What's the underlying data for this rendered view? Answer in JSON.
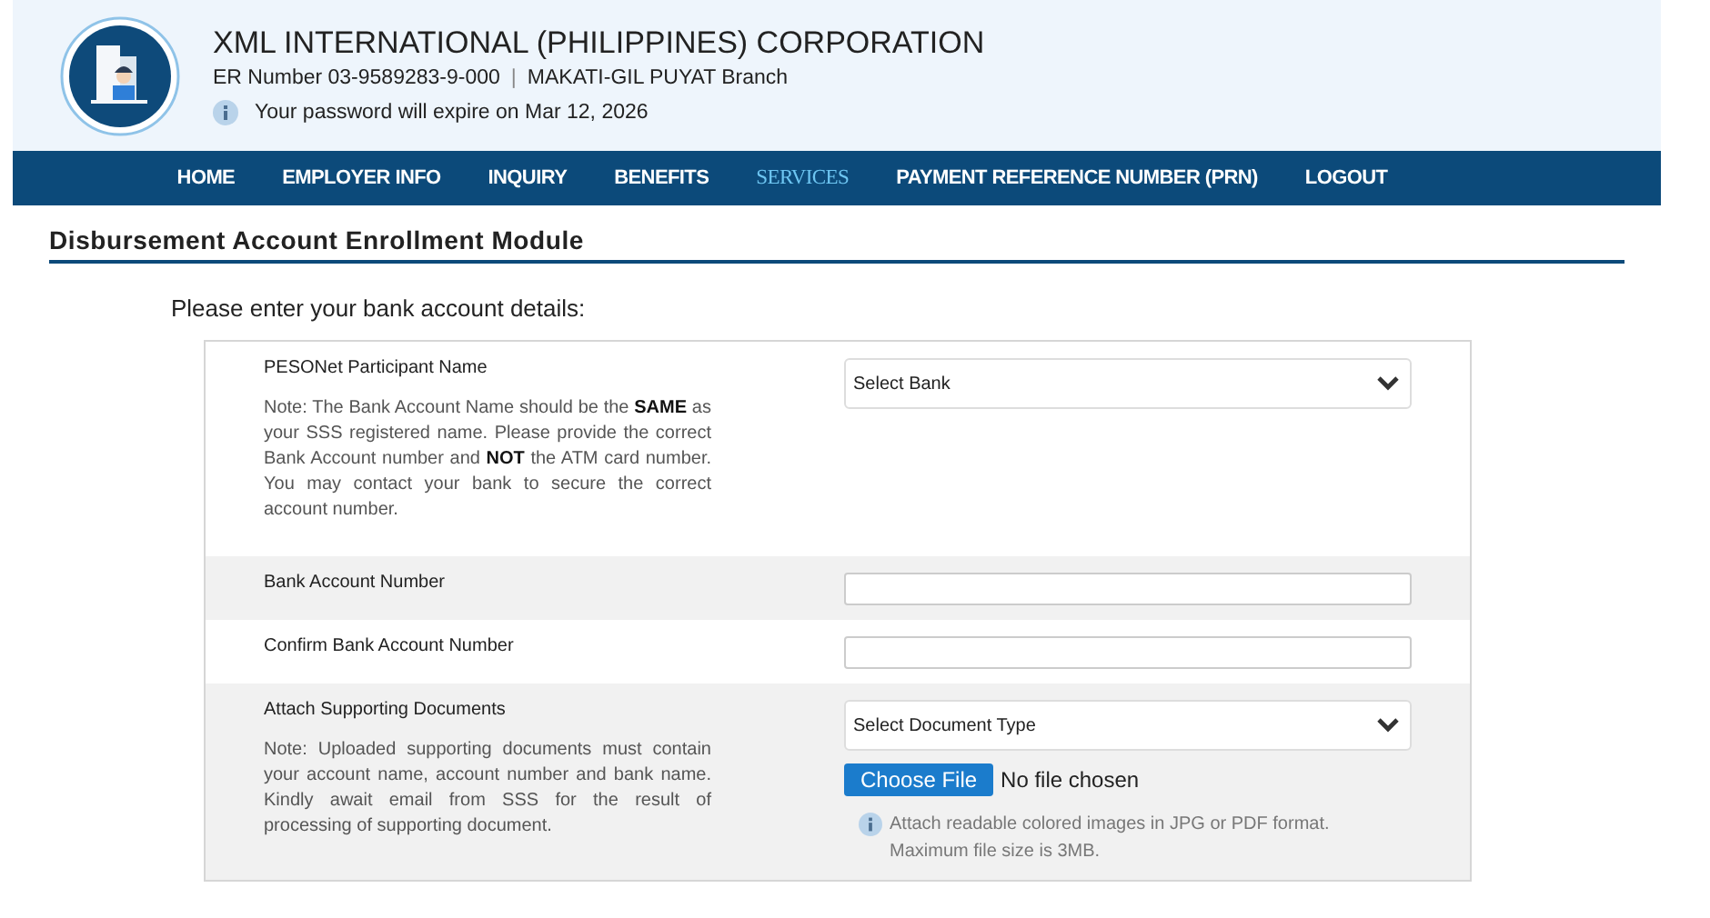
{
  "header": {
    "company": "XML INTERNATIONAL (PHILIPPINES) CORPORATION",
    "er_number": "ER Number 03-9589283-9-000",
    "separator": "|",
    "branch": "MAKATI-GIL PUYAT Branch",
    "password_notice": "Your password will expire on Mar 12, 2026"
  },
  "nav": [
    {
      "label": "HOME",
      "selected": false
    },
    {
      "label": "EMPLOYER INFO",
      "selected": false
    },
    {
      "label": "INQUIRY",
      "selected": false
    },
    {
      "label": "BENEFITS",
      "selected": false
    },
    {
      "label": "SERVICES",
      "selected": true
    },
    {
      "label": "PAYMENT REFERENCE NUMBER (PRN)",
      "selected": false
    },
    {
      "label": "LOGOUT",
      "selected": false
    }
  ],
  "module_title": "Disbursement Account Enrollment Module",
  "instruction": "Please enter your bank account details:",
  "rows": [
    {
      "label": "PESONet Participant Name",
      "note": "Note: The Bank Account Name should be the **SAME** as your SSS registered name. Please provide the correct Bank Account number and **NOT** the ATM card number. You may contact your bank to secure the correct account number.",
      "kind": "select",
      "placeholder": "Select Bank"
    },
    {
      "label": "Bank Account Number",
      "kind": "input"
    },
    {
      "label": "Confirm Bank Account Number",
      "kind": "input"
    },
    {
      "label": "Attach Supporting Documents",
      "note": "Note: Uploaded supporting documents must contain your account name, account number and bank name. Kindly await email from SSS for the result of processing of supporting document.",
      "kind": "upload",
      "placeholder": "Select Document Type",
      "file_button": "Choose File",
      "file_status": "No file chosen",
      "hint": "Attach readable colored images in JPG or PDF format. Maximum file size is 3MB."
    }
  ]
}
